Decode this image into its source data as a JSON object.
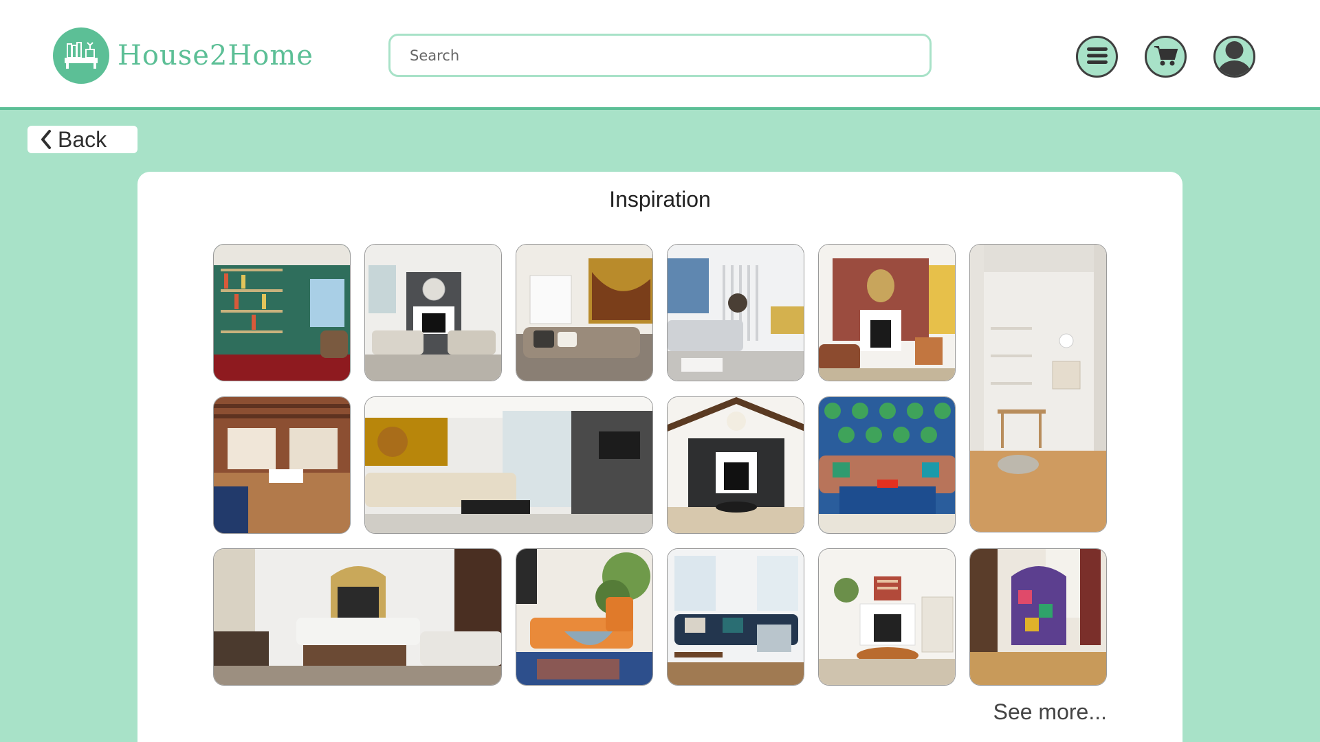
{
  "header": {
    "brand": "House2Home",
    "search_placeholder": "Search",
    "buttons": [
      "menu-button",
      "cart-button",
      "profile-button"
    ]
  },
  "nav": {
    "back_label": "Back"
  },
  "main": {
    "title": "Inspiration",
    "see_more_label": "See more...",
    "tiles": [
      {
        "desc": "green library living room with red rug"
      },
      {
        "desc": "neutral living room with fireplace and round mirror"
      },
      {
        "desc": "beige sofa with abstract yellow wall art"
      },
      {
        "desc": "grey sectional with slatted divider"
      },
      {
        "desc": "terracotta wall with fireplace and mirror"
      },
      {
        "desc": "white hallway with shelves and desk"
      },
      {
        "desc": "brick loft with wooden floors"
      },
      {
        "desc": "cream sofa with golden buddha wall art"
      },
      {
        "desc": "black fireplace wall with wooden beams"
      },
      {
        "desc": "colorful patterned wallpaper with sofa"
      },
      {
        "desc": "white sofas with ornate gold mirror"
      },
      {
        "desc": "orange daybed with plants"
      },
      {
        "desc": "navy sofa in bright room"
      },
      {
        "desc": "white fireplace with round coffee table"
      },
      {
        "desc": "patchwork armchair on wooden floor"
      }
    ]
  },
  "colors": {
    "brand_green": "#5cbf96",
    "mint_background": "#a8e2c8",
    "dark_icon": "#3f3f3f"
  }
}
